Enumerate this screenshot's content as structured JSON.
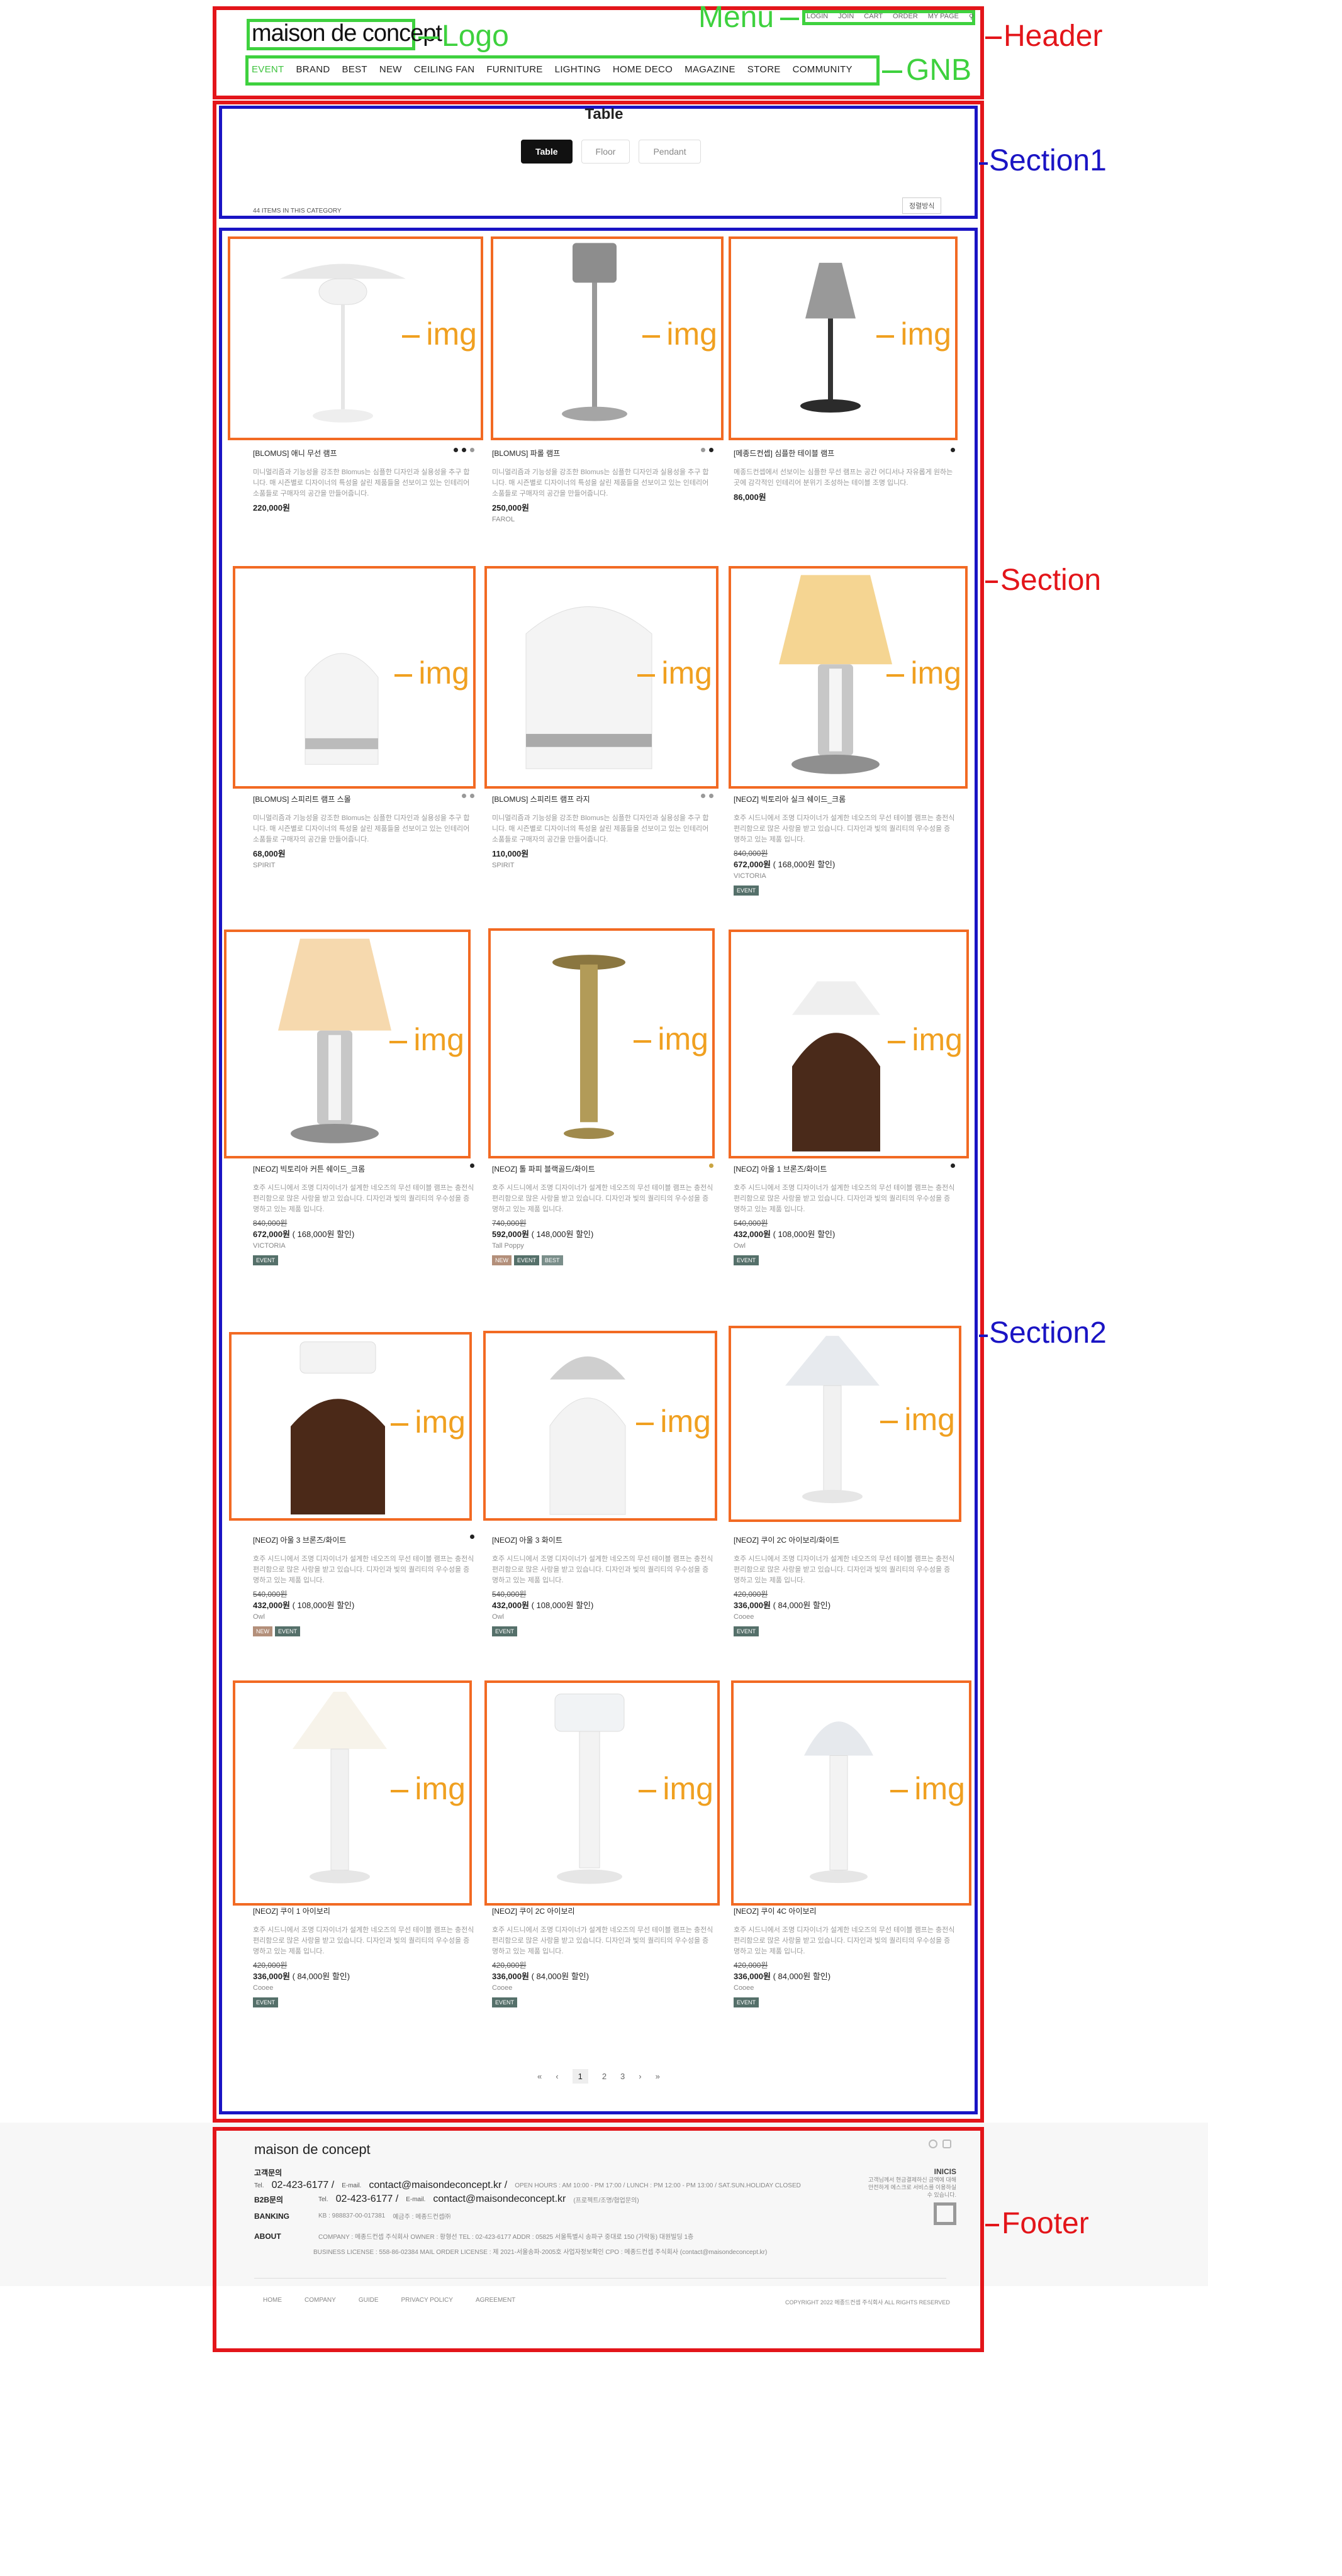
{
  "annotations": {
    "header": "Header",
    "menu": "Menu",
    "logo": "Logo",
    "gnb": "GNB",
    "section1": "Section1",
    "section": "Section",
    "section2": "Section2",
    "footer": "Footer",
    "img": "img"
  },
  "header": {
    "logo": "maison de concept",
    "menu": [
      "LOGIN",
      "JOIN",
      "CART",
      "ORDER",
      "MY PAGE"
    ],
    "gnb": [
      "EVENT",
      "BRAND",
      "BEST",
      "NEW",
      "CEILING FAN",
      "FURNITURE",
      "LIGHTING",
      "HOME DECO",
      "MAGAZINE",
      "STORE",
      "COMMUNITY"
    ]
  },
  "section1": {
    "title": "Table",
    "tabs": [
      "Table",
      "Floor",
      "Pendant"
    ],
    "count": "44 ITEMS IN THIS CATEGORY",
    "sort": "정렬방식"
  },
  "products": [
    {
      "name": "[BLOMUS] 애니 무선 램프",
      "desc": "미니멀리즘과 기능성을 강조한 Blomus는 심플한 디자인과 실용성을 추구 합니다. 매 시즌별로 디자이너의 특성을 살린 제품들을 선보이고 있는 인테리어 소품들로 구매자의 공간을 만들어줍니다.",
      "old": "",
      "price": "220,000원",
      "disc": "",
      "brand": "",
      "badges": []
    },
    {
      "name": "[BLOMUS] 파롤 램프",
      "desc": "미니멀리즘과 기능성을 강조한 Blomus는 심플한 디자인과 실용성을 추구 합니다. 매 시즌별로 디자이너의 특성을 살린 제품들을 선보이고 있는 인테리어 소품들로 구매자의 공간을 만들어줍니다.",
      "old": "",
      "price": "250,000원",
      "disc": "",
      "brand": "FAROL",
      "badges": []
    },
    {
      "name": "[메종드컨셉] 심플한 테이블 램프",
      "desc": "메종드컨셉에서 선보이는 심플한 무선 램프는 공간 어디서나 자유롭게 원하는 곳에 감각적인 인테리어 분위기 조성하는 테이블 조명 입니다.",
      "old": "",
      "price": "86,000원",
      "disc": "",
      "brand": "",
      "badges": []
    },
    {
      "name": "[BLOMUS] 스피리트 램프 스몰",
      "desc": "미니멀리즘과 기능성을 강조한 Blomus는 심플한 디자인과 실용성을 추구 합니다. 매 시즌별로 디자이너의 특성을 살린 제품들을 선보이고 있는 인테리어 소품들로 구매자의 공간을 만들어줍니다.",
      "old": "",
      "price": "68,000원",
      "disc": "",
      "brand": "SPIRIT",
      "badges": []
    },
    {
      "name": "[BLOMUS] 스피리트 램프 라지",
      "desc": "미니멀리즘과 기능성을 강조한 Blomus는 심플한 디자인과 실용성을 추구 합니다. 매 시즌별로 디자이너의 특성을 살린 제품들을 선보이고 있는 인테리어 소품들로 구매자의 공간을 만들어줍니다.",
      "old": "",
      "price": "110,000원",
      "disc": "",
      "brand": "SPIRIT",
      "badges": []
    },
    {
      "name": "[NEOZ] 빅토리아 실크 쉐이드_크롬",
      "desc": "호주 시드니에서 조명 디자이너가 설계한 네오즈의 무선 테이블 램프는 충전식 편리함으로 많은 사랑을 받고 있습니다. 디자인과 빛의 퀄리티의 우수성을 증명하고 있는 제품 입니다.",
      "old": "840,000원",
      "price": "672,000원",
      "disc": " ( 168,000원 할인)",
      "brand": "VICTORIA",
      "badges": [
        "EVENT"
      ]
    },
    {
      "name": "[NEOZ] 빅토리아 커튼 쉐이드_크롬",
      "desc": "호주 시드니에서 조명 디자이너가 설계한 네오즈의 무선 테이블 램프는 충전식 편리함으로 많은 사랑을 받고 있습니다. 디자인과 빛의 퀄리티의 우수성을 증명하고 있는 제품 입니다.",
      "old": "840,000원",
      "price": "672,000원",
      "disc": " ( 168,000원 할인)",
      "brand": "VICTORIA",
      "badges": [
        "EVENT"
      ]
    },
    {
      "name": "[NEOZ] 톨 파피 블랙골드/화이트",
      "desc": "호주 시드니에서 조명 디자이너가 설계한 네오즈의 무선 테이블 램프는 충전식 편리함으로 많은 사랑을 받고 있습니다. 디자인과 빛의 퀄리티의 우수성을 증명하고 있는 제품 입니다.",
      "old": "740,000원",
      "price": "592,000원",
      "disc": " ( 148,000원 할인)",
      "brand": "Tall Poppy",
      "badges": [
        "NEW",
        "EVENT",
        "BEST"
      ]
    },
    {
      "name": "[NEOZ] 아울 1 브론즈/화이트",
      "desc": "호주 시드니에서 조명 디자이너가 설계한 네오즈의 무선 테이블 램프는 충전식 편리함으로 많은 사랑을 받고 있습니다. 디자인과 빛의 퀄리티의 우수성을 증명하고 있는 제품 입니다.",
      "old": "540,000원",
      "price": "432,000원",
      "disc": " ( 108,000원 할인)",
      "brand": "Owl",
      "badges": [
        "EVENT"
      ]
    },
    {
      "name": "[NEOZ] 아울 3 브론즈/화이트",
      "desc": "호주 시드니에서 조명 디자이너가 설계한 네오즈의 무선 테이블 램프는 충전식 편리함으로 많은 사랑을 받고 있습니다. 디자인과 빛의 퀄리티의 우수성을 증명하고 있는 제품 입니다.",
      "old": "540,000원",
      "price": "432,000원",
      "disc": " ( 108,000원 할인)",
      "brand": "Owl",
      "badges": [
        "NEW",
        "EVENT"
      ]
    },
    {
      "name": "[NEOZ] 아울 3 화이트",
      "desc": "호주 시드니에서 조명 디자이너가 설계한 네오즈의 무선 테이블 램프는 충전식 편리함으로 많은 사랑을 받고 있습니다. 디자인과 빛의 퀄리티의 우수성을 증명하고 있는 제품 입니다.",
      "old": "540,000원",
      "price": "432,000원",
      "disc": " ( 108,000원 할인)",
      "brand": "Owl",
      "badges": [
        "EVENT"
      ]
    },
    {
      "name": "[NEOZ] 쿠이 2C 아이보리/화이트",
      "desc": "호주 시드니에서 조명 디자이너가 설계한 네오즈의 무선 테이블 램프는 충전식 편리함으로 많은 사랑을 받고 있습니다. 디자인과 빛의 퀄리티의 우수성을 증명하고 있는 제품 입니다.",
      "old": "420,000원",
      "price": "336,000원",
      "disc": " ( 84,000원 할인)",
      "brand": "Cooee",
      "badges": [
        "EVENT"
      ]
    },
    {
      "name": "[NEOZ] 쿠이 1 아이보리",
      "desc": "호주 시드니에서 조명 디자이너가 설계한 네오즈의 무선 테이블 램프는 충전식 편리함으로 많은 사랑을 받고 있습니다. 디자인과 빛의 퀄리티의 우수성을 증명하고 있는 제품 입니다.",
      "old": "420,000원",
      "price": "336,000원",
      "disc": " ( 84,000원 할인)",
      "brand": "Cooee",
      "badges": [
        "EVENT"
      ]
    },
    {
      "name": "[NEOZ] 쿠이 2C 아이보리",
      "desc": "호주 시드니에서 조명 디자이너가 설계한 네오즈의 무선 테이블 램프는 충전식 편리함으로 많은 사랑을 받고 있습니다. 디자인과 빛의 퀄리티의 우수성을 증명하고 있는 제품 입니다.",
      "old": "420,000원",
      "price": "336,000원",
      "disc": " ( 84,000원 할인)",
      "brand": "Cooee",
      "badges": [
        "EVENT"
      ]
    },
    {
      "name": "[NEOZ] 쿠이 4C 아이보리",
      "desc": "호주 시드니에서 조명 디자이너가 설계한 네오즈의 무선 테이블 램프는 충전식 편리함으로 많은 사랑을 받고 있습니다. 디자인과 빛의 퀄리티의 우수성을 증명하고 있는 제품 입니다.",
      "old": "420,000원",
      "price": "336,000원",
      "disc": " ( 84,000원 할인)",
      "brand": "Cooee",
      "badges": [
        "EVENT"
      ]
    }
  ],
  "pagination": [
    "«",
    "‹",
    "1",
    "2",
    "3",
    "›",
    "»"
  ],
  "footer": {
    "logo": "maison de concept",
    "cs_label": "고객문의",
    "tel1": "02-423-6177 /",
    "email1": "contact@maisondeconcept.kr /",
    "hours": "OPEN HOURS : AM 10:00 - PM 17:00 / LUNCH : PM 12:00 - PM 13:00 / SAT.SUN.HOLIDAY CLOSED",
    "b2b_label": "B2B문의",
    "tel2": "02-423-6177 /",
    "email2": "contact@maisondeconcept.kr",
    "b2b_note": "(프로젝트/조명/협업문의)",
    "banking_label": "BANKING",
    "bank": "KB : 988837-00-017381",
    "holder": "예금주 : 메종드컨셉㈜",
    "about_label": "ABOUT",
    "about1": "COMPANY : 메종드컨셉 주식회사    OWNER : 황형선    TEL : 02-423-6177    ADDR : 05825 서울특별시 송파구 중대로 150 (가락동) 대원빌딩 1층",
    "about2": "BUSINESS LICENSE : 558-86-02384    MAIL ORDER LICENSE : 제 2021-서울송파-2005호    사업자정보확인    CPO : 메종드컨셉 주식회사 (contact@maisondeconcept.kr)",
    "inicis": "INICIS",
    "inicis_text": "고객님께서 현금결제하신 금액에 대해 안전하게 에스크로 서비스를 이용하실 수 있습니다.",
    "links": [
      "HOME",
      "COMPANY",
      "GUIDE",
      "PRIVACY POLICY",
      "AGREEMENT"
    ],
    "copyright": "COPYRIGHT 2022 메종드컨셉 주식회사 ALL RIGHTS RESERVED"
  }
}
